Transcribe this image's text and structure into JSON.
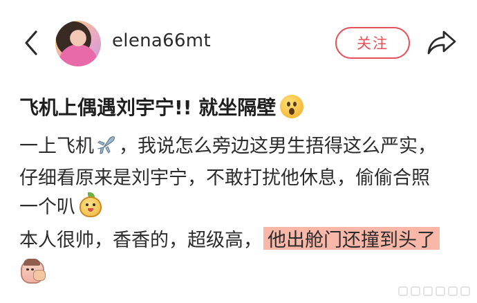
{
  "header": {
    "username": "elena66mt",
    "follow_label": "关注"
  },
  "post": {
    "title": "飞机上偶遇刘宇宁!! 就坐隔壁",
    "line1_part1": "一上飞机",
    "line1_part2": "，我说怎么旁边这男生捂得这么严实，",
    "line2": "仔细看原来是刘宇宁，不敢打扰他休息，偷偷合照",
    "line3": "一个叭",
    "line4_plain": "本人很帅，香香的，超级高，",
    "line4_highlight": "他出舱门还撞到头了"
  },
  "colors": {
    "accent": "#e8505b",
    "highlight": "#f9b7a8"
  },
  "icons": {
    "back": "chevron-left-icon",
    "share": "share-arrow-icon",
    "title_emoji": "surprised-face-icon",
    "airplane": "airplane-icon",
    "mango": "mango-sticker-icon",
    "bottom": "shy-face-sticker-icon"
  }
}
